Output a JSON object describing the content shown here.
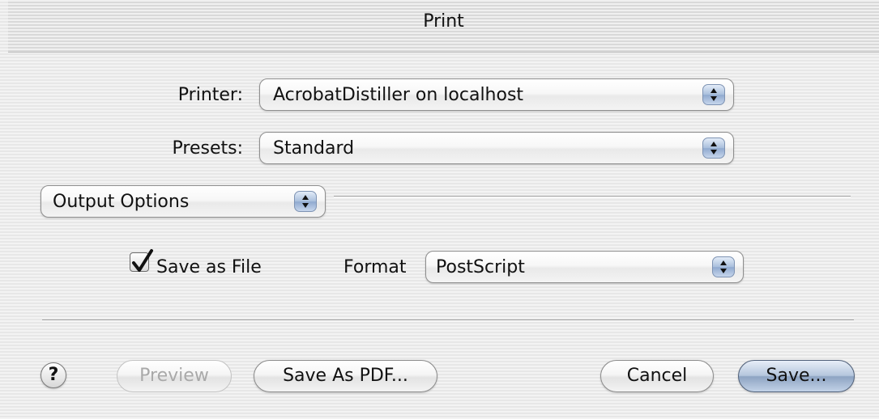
{
  "window": {
    "title": "Print"
  },
  "printer": {
    "label": "Printer:",
    "value": "AcrobatDistiller  on localhost"
  },
  "presets": {
    "label": "Presets:",
    "value": "Standard"
  },
  "panel": {
    "value": "Output Options"
  },
  "output": {
    "save_as_file_label": "Save as File",
    "save_as_file_checked": true,
    "format_label": "Format",
    "format_value": "PostScript"
  },
  "buttons": {
    "help": "?",
    "preview": "Preview",
    "save_as_pdf": "Save As PDF...",
    "cancel": "Cancel",
    "save": "Save..."
  },
  "icons": {
    "help": "question-mark-icon",
    "popup_arrows": "up-down-arrows-icon",
    "checkmark": "checkmark-icon"
  }
}
